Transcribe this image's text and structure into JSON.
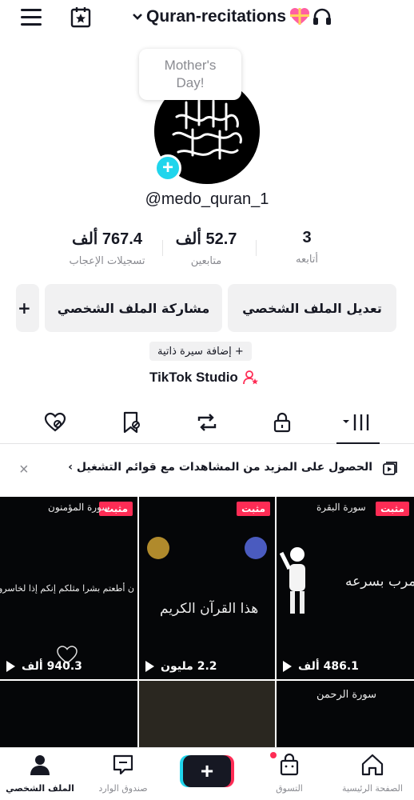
{
  "header": {
    "title": "Quran-recitations",
    "icons": [
      "menu-icon",
      "calendar-star-icon",
      "chevron-down-icon",
      "heart-gift-emoji",
      "headphones-emoji"
    ]
  },
  "profile": {
    "bubble_text": "Mother's Day!",
    "username": "@medo_quran_1",
    "avatar_add": "+"
  },
  "stats": {
    "likes": {
      "value": "767.4 ألف",
      "label": "تسجيلات الإعجاب"
    },
    "followers": {
      "value": "52.7 ألف",
      "label": "متابعين"
    },
    "following": {
      "value": "3",
      "label": "أتابعه"
    }
  },
  "actions": {
    "edit_profile": "تعديل الملف الشخصي",
    "share_profile": "مشاركة الملف الشخصي",
    "add_friend": "+"
  },
  "bio": {
    "add_bio": "+ إضافة سيرة ذاتية",
    "studio": "TikTok Studio"
  },
  "tabs": [
    "videos-grid-icon",
    "lock-icon",
    "repost-icon",
    "favorites-icon",
    "liked-icon"
  ],
  "promo": {
    "text": "الحصول على المزيد من المشاهدات مع قوائم التشغيل ›",
    "close": "×"
  },
  "videos": [
    {
      "pinned": "مثبت",
      "plays": "486.1 ألف",
      "overlay_top": "سورة البقرة",
      "overlay_mid": "مرب بسرعه"
    },
    {
      "pinned": "مثبت",
      "plays": "2.2 مليون",
      "overlay_top": "",
      "overlay_mid": "هذا القرآن الكريم"
    },
    {
      "pinned": "مثبت",
      "plays": "940.3 ألف",
      "overlay_top": "سورة المؤمنون",
      "overlay_mid": "ن أطعتم بشرا مثلكم إنكم إذا لخاسرون"
    },
    {
      "pinned": "",
      "plays": "",
      "overlay_top": "سورة الرحمن",
      "overlay_mid": ""
    }
  ],
  "bottom_nav": {
    "home": "الصفحة الرئيسية",
    "shop": "التسوق",
    "create": "+",
    "inbox": "صندوق الوارد",
    "profile": "الملف الشخصي"
  },
  "colors": {
    "accent_red": "#fe2c55",
    "accent_cyan": "#20d5ec",
    "text": "#161823",
    "muted": "#8a8b91"
  }
}
